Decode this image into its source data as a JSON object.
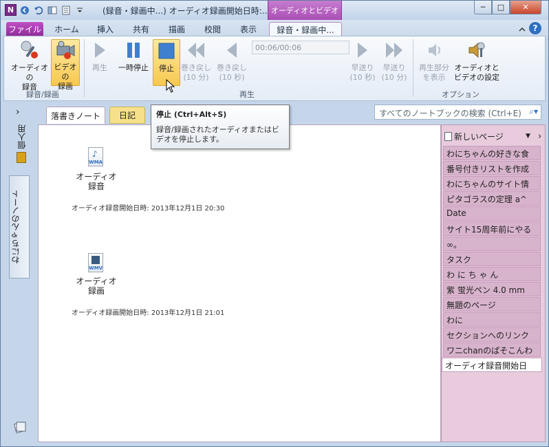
{
  "window": {
    "title": "(録音・録画中...) オーディオ録画開始日時:...",
    "context_tab": "オーディオとビデオ",
    "min": "─",
    "max": "□",
    "close": "✕"
  },
  "tabs": {
    "file": "ファイル",
    "home": "ホーム",
    "insert": "挿入",
    "share": "共有",
    "draw": "描画",
    "review": "校閲",
    "view": "表示",
    "recording": "録音・録画中..."
  },
  "ribbon": {
    "audio_record": [
      "オーディオの",
      "録音"
    ],
    "video_record": [
      "ビデオの",
      "録画"
    ],
    "group_record": "録音/録画",
    "play": "再生",
    "pause": "一時停止",
    "stop": "停止",
    "rewind10m": [
      "巻き戻し",
      "(10 分)"
    ],
    "rewind10s": [
      "巻き戻し",
      "(10 秒)"
    ],
    "time": "00:06/00:06",
    "ff10s": [
      "早送り",
      "(10 秒)"
    ],
    "ff10m": [
      "早送り",
      "(10 分)"
    ],
    "group_play": "再生",
    "show_playing": [
      "再生部分",
      "を表示"
    ],
    "av_settings": [
      "オーディオと",
      "ビデオの設定"
    ],
    "group_options": "オプション"
  },
  "tooltip": {
    "title": "停止 (Ctrl+Alt+S)",
    "desc": "録音/録画されたオーディオまたはビデオを停止します。"
  },
  "leftnav": {
    "expand": "›",
    "personal": "個人用",
    "notebook": "わにちゃんのノート"
  },
  "sections": {
    "tab1": "落書きノート",
    "tab2": "日記"
  },
  "search": {
    "placeholder": "すべてのノートブックの検索 (Ctrl+E)"
  },
  "page": {
    "audio": {
      "label": [
        "オーディオ",
        "録音"
      ],
      "badge": "WMA",
      "stamp": "オーディオ録音開始日時: 2013年12月1日 20:30"
    },
    "video": {
      "label": [
        "オーディオ",
        "録画"
      ],
      "badge": "WMV",
      "stamp": "オーディオ録画開始日時: 2013年12月1日 21:01"
    }
  },
  "pagelist": {
    "new_page": "新しいページ",
    "items": [
      "わにちゃんの好きな食",
      "番号付きリストを作成",
      "わにちゃんのサイト情",
      "ピタゴラスの定理   a^",
      "Date",
      "サイト15周年前にやる",
      "∞。",
      "タスク",
      "わ に ち ゃ ん",
      "紫 蛍光ペン 4.0 mm",
      "無題のページ",
      "わに",
      "セクションへのリンク",
      "ワニchanのぱそこんわ",
      "オーディオ録音開始日"
    ]
  }
}
